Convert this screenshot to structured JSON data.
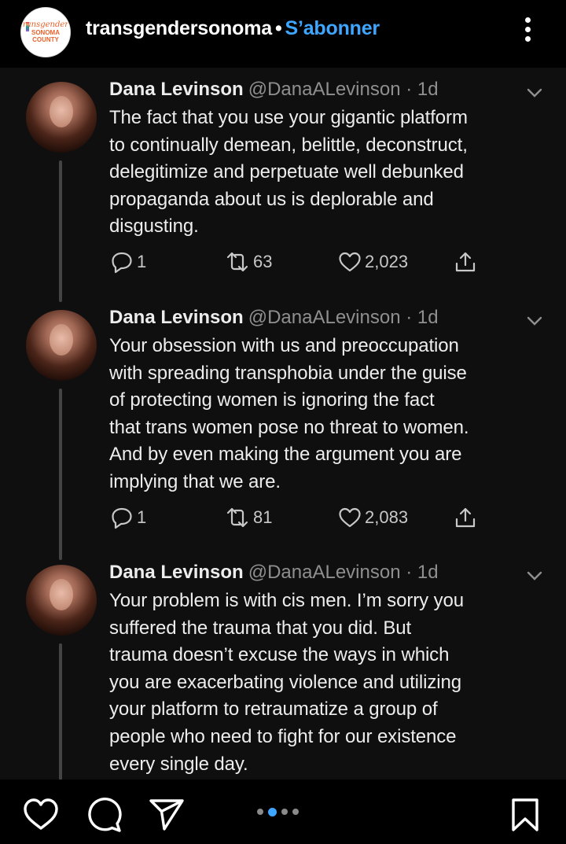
{
  "header": {
    "account": "transgendersonoma",
    "separator": "•",
    "follow_label": "S’abonner",
    "logo": {
      "line1": "ransgender",
      "line2": "SONOMA",
      "line3": "COUNTY"
    }
  },
  "tweets": [
    {
      "name": "Dana Levinson",
      "handle": "@DanaALevinson · 1d",
      "text": "The fact that you use your gigantic platform\nto continually demean, belittle, deconstruct,\ndelegitimize and perpetuate well debunked\npropaganda about us is deplorable and\ndisgusting.",
      "replies": "1",
      "retweets": "63",
      "likes": "2,023"
    },
    {
      "name": "Dana Levinson",
      "handle": "@DanaALevinson · 1d",
      "text": "Your obsession with us and preoccupation\nwith spreading transphobia under the guise\nof protecting women is ignoring the fact\nthat trans women pose no threat to women.\nAnd by even making the argument you are\nimplying that we are.",
      "replies": "1",
      "retweets": "81",
      "likes": "2,083"
    },
    {
      "name": "Dana Levinson",
      "handle": "@DanaALevinson · 1d",
      "text": "Your problem is with cis men. I’m sorry you\nsuffered the trauma that you did. But\ntrauma doesn’t excuse the ways in which\nyou are exacerbating violence and utilizing\nyour platform to retraumatize a group of\npeople who need to fight for our existence\nevery single day."
    }
  ],
  "carousel": {
    "count": 4,
    "active_index": 1
  },
  "icons": [
    "heart-icon",
    "comment-icon",
    "share-icon",
    "bookmark-icon",
    "more-icon",
    "chevron-down-icon",
    "reply-icon",
    "retweet-icon",
    "like-icon",
    "upload-icon"
  ],
  "colors": {
    "accent": "#3ea6ff",
    "background": "#0f0f10",
    "text": "#ededed",
    "muted": "#8f8f8f"
  }
}
